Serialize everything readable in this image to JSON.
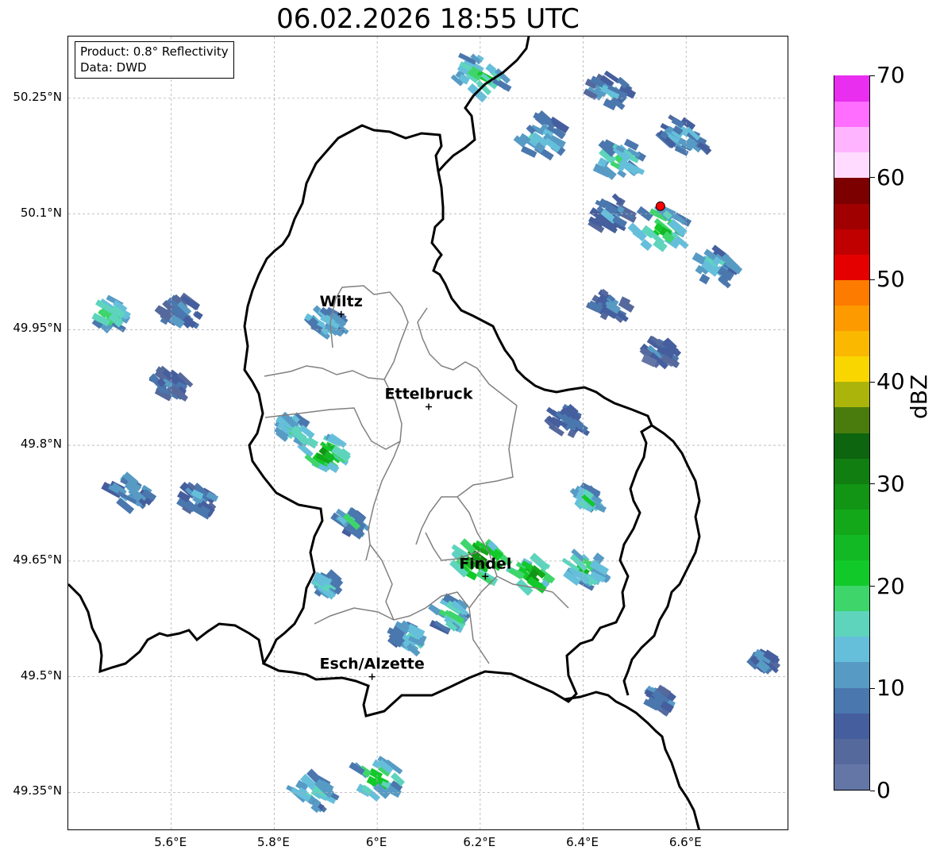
{
  "title": "06.02.2026 18:55 UTC",
  "info": {
    "product": "Product: 0.8° Reflectivity",
    "data": "Data: DWD"
  },
  "map": {
    "lat_range": [
      49.3,
      50.33
    ],
    "lon_range": [
      5.4,
      6.8
    ],
    "lat_ticks": [
      "50.25°N",
      "50.1°N",
      "49.95°N",
      "49.8°N",
      "49.65°N",
      "49.5°N",
      "49.35°N"
    ],
    "lat_values": [
      50.25,
      50.1,
      49.95,
      49.8,
      49.65,
      49.5,
      49.35
    ],
    "lon_ticks": [
      "5.6°E",
      "5.8°E",
      "6°E",
      "6.2°E",
      "6.4°E",
      "6.6°E"
    ],
    "lon_values": [
      5.6,
      5.8,
      6.0,
      6.2,
      6.4,
      6.6
    ],
    "grid": true
  },
  "cities": [
    {
      "name": "Wiltz",
      "lon": 5.93,
      "lat": 49.97
    },
    {
      "name": "Ettelbruck",
      "lon": 6.1,
      "lat": 49.85
    },
    {
      "name": "Findel",
      "lon": 6.21,
      "lat": 49.63
    },
    {
      "name": "Esch/Alzette",
      "lon": 5.99,
      "lat": 49.5
    }
  ],
  "radar_site": {
    "lon": 6.55,
    "lat": 50.11,
    "color": "#ff0000"
  },
  "colorbar": {
    "label": "dBZ",
    "tick_labels": [
      "0",
      "10",
      "20",
      "30",
      "40",
      "50",
      "60",
      "70"
    ],
    "tick_values": [
      0,
      10,
      20,
      30,
      40,
      50,
      60,
      70
    ],
    "min": 0,
    "max": 70,
    "step": 2.5,
    "colors": [
      "#6376a6",
      "#56699d",
      "#455e9d",
      "#4a77ad",
      "#579bc5",
      "#65bfdb",
      "#5ed4bd",
      "#3ed56b",
      "#12c92a",
      "#12b924",
      "#13a81a",
      "#129515",
      "#117e11",
      "#0d650f",
      "#4a7c0d",
      "#abb40a",
      "#fad600",
      "#fbb800",
      "#fc9a00",
      "#fd7c00",
      "#e50000",
      "#c00000",
      "#a00000",
      "#7d0000",
      "#ffdcff",
      "#ffb4ff",
      "#ff6eff",
      "#ea2ef0"
    ]
  },
  "echo_cells": [
    {
      "lon": 6.2,
      "lat": 50.28,
      "dbz": 22,
      "size": 0.05
    },
    {
      "lon": 6.32,
      "lat": 50.2,
      "dbz": 17,
      "size": 0.045
    },
    {
      "lon": 6.45,
      "lat": 50.26,
      "dbz": 14,
      "size": 0.04
    },
    {
      "lon": 6.47,
      "lat": 50.17,
      "dbz": 20,
      "size": 0.045
    },
    {
      "lon": 6.6,
      "lat": 50.2,
      "dbz": 14,
      "size": 0.045
    },
    {
      "lon": 6.55,
      "lat": 50.08,
      "dbz": 25,
      "size": 0.05
    },
    {
      "lon": 6.66,
      "lat": 50.03,
      "dbz": 17,
      "size": 0.04
    },
    {
      "lon": 6.45,
      "lat": 50.1,
      "dbz": 12,
      "size": 0.04
    },
    {
      "lon": 6.45,
      "lat": 49.98,
      "dbz": 10,
      "size": 0.035
    },
    {
      "lon": 6.55,
      "lat": 49.92,
      "dbz": 9,
      "size": 0.03
    },
    {
      "lon": 6.37,
      "lat": 49.83,
      "dbz": 10,
      "size": 0.035
    },
    {
      "lon": 5.48,
      "lat": 49.97,
      "dbz": 22,
      "size": 0.035
    },
    {
      "lon": 5.62,
      "lat": 49.97,
      "dbz": 13,
      "size": 0.035
    },
    {
      "lon": 5.9,
      "lat": 49.96,
      "dbz": 20,
      "size": 0.03
    },
    {
      "lon": 5.6,
      "lat": 49.88,
      "dbz": 11,
      "size": 0.03
    },
    {
      "lon": 5.9,
      "lat": 49.79,
      "dbz": 30,
      "size": 0.04
    },
    {
      "lon": 5.84,
      "lat": 49.82,
      "dbz": 20,
      "size": 0.03
    },
    {
      "lon": 5.52,
      "lat": 49.74,
      "dbz": 16,
      "size": 0.04
    },
    {
      "lon": 5.65,
      "lat": 49.73,
      "dbz": 14,
      "size": 0.035
    },
    {
      "lon": 5.95,
      "lat": 49.7,
      "dbz": 18,
      "size": 0.025
    },
    {
      "lon": 6.2,
      "lat": 49.65,
      "dbz": 34,
      "size": 0.05
    },
    {
      "lon": 6.3,
      "lat": 49.63,
      "dbz": 30,
      "size": 0.04
    },
    {
      "lon": 6.4,
      "lat": 49.64,
      "dbz": 22,
      "size": 0.04
    },
    {
      "lon": 6.14,
      "lat": 49.58,
      "dbz": 22,
      "size": 0.035
    },
    {
      "lon": 6.06,
      "lat": 49.55,
      "dbz": 20,
      "size": 0.03
    },
    {
      "lon": 6.41,
      "lat": 49.73,
      "dbz": 20,
      "size": 0.025
    },
    {
      "lon": 5.9,
      "lat": 49.62,
      "dbz": 17,
      "size": 0.025
    },
    {
      "lon": 6.0,
      "lat": 49.37,
      "dbz": 25,
      "size": 0.045
    },
    {
      "lon": 5.88,
      "lat": 49.35,
      "dbz": 18,
      "size": 0.04
    },
    {
      "lon": 6.55,
      "lat": 49.47,
      "dbz": 13,
      "size": 0.025
    },
    {
      "lon": 6.75,
      "lat": 49.52,
      "dbz": 14,
      "size": 0.02
    }
  ]
}
